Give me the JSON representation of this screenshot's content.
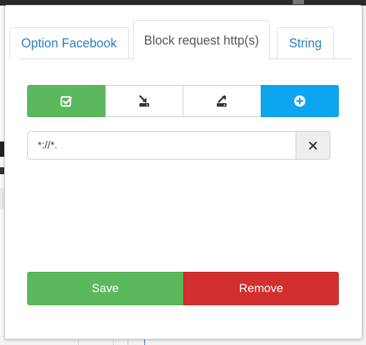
{
  "tabs": [
    {
      "label": "Option Facebook",
      "active": false
    },
    {
      "label": "Block request http(s)",
      "active": true
    },
    {
      "label": "String",
      "active": false
    }
  ],
  "toolbar": {
    "buttons": [
      {
        "icon": "check-square-icon",
        "color": "#5cb85c"
      },
      {
        "icon": "import-icon",
        "color": "#ffffff"
      },
      {
        "icon": "export-icon",
        "color": "#ffffff"
      },
      {
        "icon": "plus-circle-icon",
        "color": "#0ea5f0"
      }
    ]
  },
  "url_field": {
    "value": "*://*.",
    "clear_icon": "close-icon"
  },
  "actions": {
    "save_label": "Save",
    "remove_label": "Remove"
  },
  "colors": {
    "tab_link": "#2a7fbf",
    "tab_active_text": "#555555",
    "save": "#5cb85c",
    "remove": "#d22f2f",
    "add": "#0ea5f0"
  }
}
